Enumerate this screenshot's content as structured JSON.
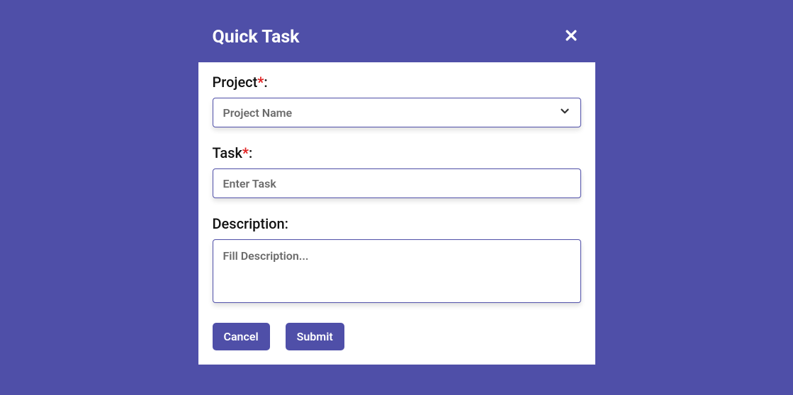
{
  "modal": {
    "title": "Quick Task",
    "fields": {
      "project": {
        "label": "Project",
        "placeholder": "Project Name"
      },
      "task": {
        "label": "Task",
        "placeholder": "Enter Task"
      },
      "description": {
        "label": "Description:",
        "placeholder": "Fill Description..."
      }
    },
    "buttons": {
      "cancel": "Cancel",
      "submit": "Submit"
    }
  }
}
